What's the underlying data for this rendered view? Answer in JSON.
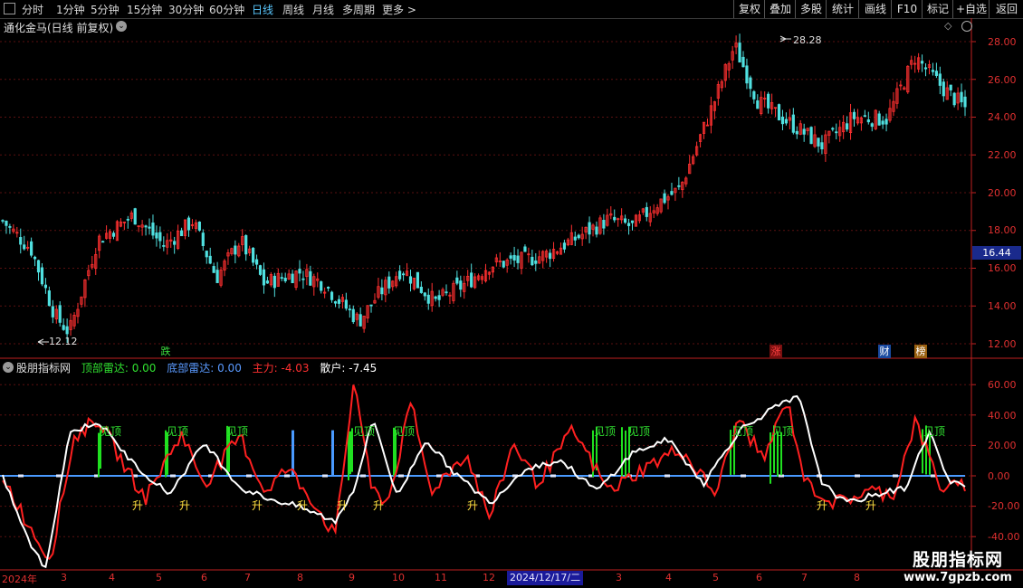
{
  "toolbar": {
    "periods": [
      "分时",
      "1分钟",
      "5分钟",
      "15分钟",
      "30分钟",
      "60分钟",
      "日线",
      "周线",
      "月线",
      "多周期",
      "更多 >"
    ],
    "active_period": "日线",
    "actions": [
      "复权",
      "叠加",
      "多股",
      "统计",
      "画线",
      "F10",
      "标记",
      "+自选",
      "返回"
    ]
  },
  "price_chart": {
    "title": "通化金马(日线 前复权)",
    "high_label": "28.28",
    "low_label": "12.12",
    "current_price": "16.44",
    "y_ticks": [
      "28.00",
      "26.00",
      "24.00",
      "22.00",
      "20.00",
      "18.00",
      "16.00",
      "14.00",
      "12.00"
    ],
    "badges": [
      {
        "text": "跌",
        "color": "#3ce040",
        "bg": "none"
      },
      {
        "text": "涨",
        "color": "#ff4040",
        "bg": "#7a1010"
      },
      {
        "text": "财",
        "color": "#ffffff",
        "bg": "#1a4aa0"
      },
      {
        "text": "榜",
        "color": "#ffffff",
        "bg": "#9a6010"
      }
    ]
  },
  "indicator": {
    "name": "股朋指标网",
    "top_radar": "顶部雷达: 0.00",
    "bottom_radar": "底部雷达: 0.00",
    "main_force": "主力: -4.03",
    "retail": "散户: -7.45",
    "y_ticks": [
      "60.00",
      "40.00",
      "20.00",
      "0.00",
      "-20.00",
      "-40.00"
    ],
    "top_signal_text": "见顶",
    "bottom_signal_text": "升"
  },
  "x_axis": {
    "labels": [
      "2024年",
      "3",
      "4",
      "5",
      "6",
      "7",
      "8",
      "9",
      "10",
      "11",
      "12",
      "2024/12/17/二",
      "3",
      "4",
      "5",
      "6",
      "7",
      "8"
    ]
  },
  "watermark": {
    "cn": "股朋指标网",
    "url": "www.7gpzb.com"
  },
  "colors": {
    "up": "#ff3030",
    "down": "#50e0e0",
    "main_line": "#ff2020",
    "retail_line": "#ffffff",
    "top_bar": "#20e020",
    "bottom_bar": "#4a9aff",
    "zero_line": "#4a9aff"
  },
  "chart_data": {
    "type": "candlestick",
    "y_range": [
      12,
      28.28
    ],
    "indicator_y_range": [
      -40,
      60
    ],
    "candle_count": 270
  }
}
